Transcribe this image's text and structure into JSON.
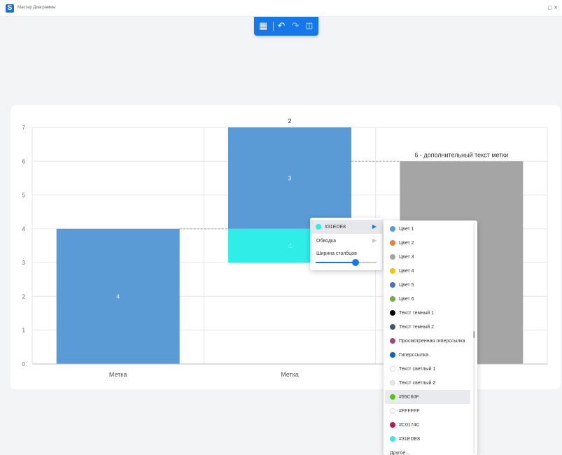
{
  "window": {
    "title": "Мастер Диаграммы",
    "restore_icon": "restore-icon",
    "close_icon": "close-icon"
  },
  "toolbar": {
    "buttons": [
      {
        "name": "chart-icon",
        "glyph": "▦"
      },
      {
        "name": "undo-icon",
        "glyph": "↶"
      },
      {
        "name": "redo-icon",
        "glyph": "↷"
      },
      {
        "name": "save-icon",
        "glyph": "🖫"
      }
    ]
  },
  "chart_data": {
    "type": "bar",
    "subtype": "waterfall",
    "ylim": [
      0,
      7
    ],
    "yticks": [
      "0",
      "1",
      "2",
      "3",
      "4",
      "5",
      "6",
      "7"
    ],
    "grid": true,
    "categories": [
      "Метка",
      "Метка",
      ""
    ],
    "bars": [
      {
        "category_index": 0,
        "base": 0,
        "top": 4,
        "label": "4",
        "color": "#5B9BD5"
      },
      {
        "category_index": 1,
        "base": 4,
        "top": 7,
        "label": "3",
        "color": "#5B9BD5"
      },
      {
        "category_index": 1,
        "base": 3,
        "top": 4,
        "label": "-1",
        "color": "#31EDE8"
      },
      {
        "category_index": 2,
        "base": 0,
        "top": 6,
        "label": "",
        "color": "#A5A5A5"
      }
    ],
    "total_labels": [
      {
        "category_index": 1,
        "value": 7,
        "text": "2"
      },
      {
        "category_index": 2,
        "value": 6,
        "text": "6 - дополнительный текст метки"
      }
    ]
  },
  "context_menu": {
    "items": [
      {
        "label": "#31EDE8",
        "dot_color": "#31EDE8",
        "has_submenu": true,
        "active": true
      },
      {
        "label": "Обводка",
        "has_submenu": true,
        "active": false
      }
    ],
    "column_width": {
      "label": "Ширина столбцов",
      "value_percent": 65
    }
  },
  "color_menu": {
    "items": [
      {
        "label": "Цвет 1",
        "color": "#5B9BD5"
      },
      {
        "label": "Цвет 2",
        "color": "#ED7D31"
      },
      {
        "label": "Цвет 3",
        "color": "#A5A5A5"
      },
      {
        "label": "Цвет 4",
        "color": "#FFC000"
      },
      {
        "label": "Цвет 5",
        "color": "#4472C4"
      },
      {
        "label": "Цвет 6",
        "color": "#70AD47"
      },
      {
        "label": "Текст темный 1",
        "color": "#000000"
      },
      {
        "label": "Текст темный 2",
        "color": "#44546A"
      },
      {
        "label": "Просмотренная гиперссылка",
        "color": "#954F72"
      },
      {
        "label": "Гиперссылка",
        "color": "#0563C1"
      },
      {
        "label": "Текст светлый 1",
        "color": "#FFFFFF"
      },
      {
        "label": "Текст светлый 2",
        "color": "#E7E6E6"
      },
      {
        "label": "#55C60F",
        "color": "#55C60F",
        "selected": true
      },
      {
        "label": "#FFFFFF",
        "color": "#FFFFFF"
      },
      {
        "label": "#C0174C",
        "color": "#C0174C"
      },
      {
        "label": "#31EDE8",
        "color": "#31EDE8"
      },
      {
        "label": "Другое...",
        "color": ""
      }
    ]
  }
}
